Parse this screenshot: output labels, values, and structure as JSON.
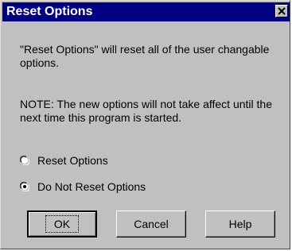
{
  "window": {
    "title": "Reset Options"
  },
  "body": {
    "message1": "\"Reset Options\" will reset all of the user changable options.",
    "message2": "NOTE: The new options will not take affect until the next time this program is started."
  },
  "options": {
    "reset": {
      "label": "Reset Options",
      "selected": false
    },
    "do_not_reset": {
      "label": "Do Not Reset Options",
      "selected": true
    }
  },
  "buttons": {
    "ok": "OK",
    "cancel": "Cancel",
    "help": "Help"
  },
  "colors": {
    "titlebar": "#000080",
    "dialog_face": "#c0c0c0"
  },
  "icons": {
    "close": "close-icon",
    "radio": "radio-icon"
  }
}
